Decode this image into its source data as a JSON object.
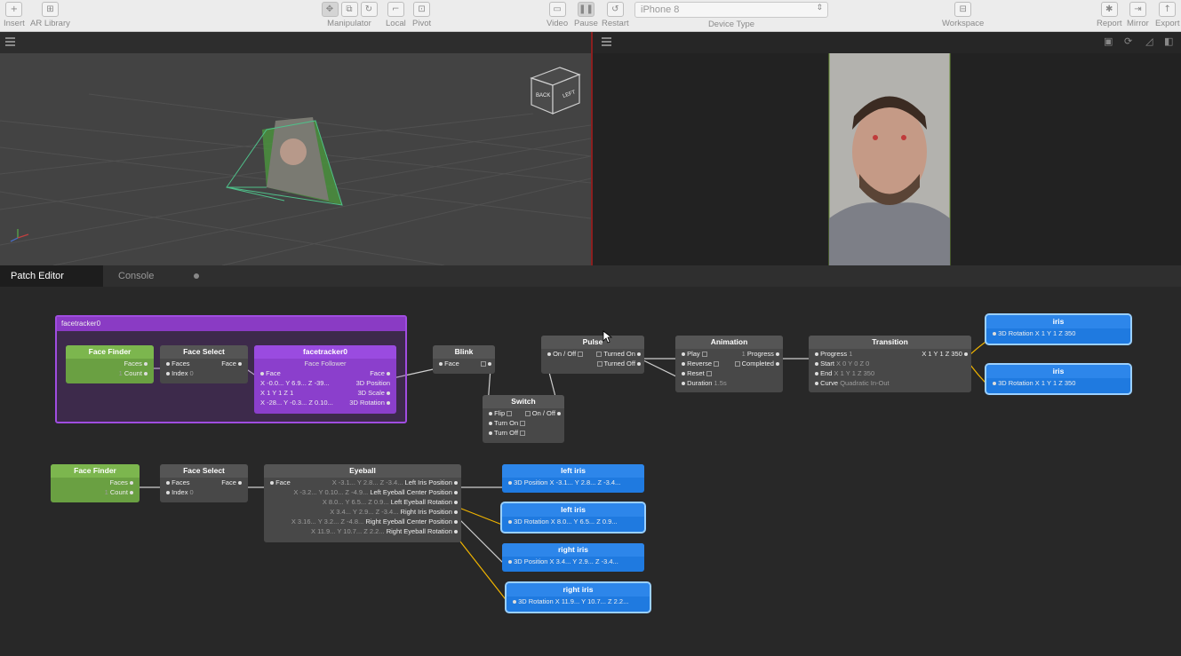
{
  "toolbar": {
    "insert": "Insert",
    "ar_library": "AR Library",
    "manipulator": "Manipulator",
    "local": "Local",
    "pivot": "Pivot",
    "video": "Video",
    "pause": "Pause",
    "restart": "Restart",
    "device_value": "iPhone 8",
    "device_label": "Device Type",
    "workspace": "Workspace",
    "report": "Report",
    "mirror": "Mirror",
    "export": "Export"
  },
  "viewport": {
    "cube_back": "BACK",
    "cube_left": "LEFT"
  },
  "tabs": {
    "patch_editor": "Patch Editor",
    "console": "Console"
  },
  "group": {
    "title": "facetracker0"
  },
  "nodes": {
    "ff1": {
      "title": "Face Finder",
      "faces": "Faces",
      "count_val": "1",
      "count": "Count"
    },
    "fs1": {
      "title": "Face Select",
      "faces": "Faces",
      "face": "Face",
      "index": "Index",
      "index_val": "0"
    },
    "ft": {
      "title": "facetracker0",
      "subtitle": "Face Follower",
      "face_in": "Face",
      "face_out": "Face",
      "r1": "X -0.0... Y 6.9... Z -39...",
      "r1_label": "3D Position",
      "r2": "X 1 Y 1 Z 1",
      "r2_label": "3D Scale",
      "r3": "X -28... Y -0.3... Z 0.10...",
      "r3_label": "3D Rotation"
    },
    "blink": {
      "title": "Blink",
      "face": "Face"
    },
    "switch": {
      "title": "Switch",
      "flip": "Flip",
      "onoff": "On / Off",
      "turn_on": "Turn On",
      "turn_off": "Turn Off"
    },
    "pulse": {
      "title": "Pulse",
      "onoff": "On / Off",
      "turned_on": "Turned On",
      "turned_off": "Turned Off"
    },
    "anim": {
      "title": "Animation",
      "play": "Play",
      "reverse": "Reverse",
      "reset": "Reset",
      "duration": "Duration",
      "duration_val": "1.5s",
      "progress_val": "1",
      "progress": "Progress",
      "completed": "Completed"
    },
    "trans": {
      "title": "Transition",
      "progress": "Progress",
      "progress_val": "1",
      "start": "Start",
      "start_val": "X 0   Y 0   Z 0",
      "end": "End",
      "end_val": "X 1   Y 1   Z 350",
      "curve": "Curve",
      "curve_val": "Quadratic In-Out",
      "out_val": "X   1 Y   1 Z   350"
    },
    "iris1": {
      "title": "iris",
      "label": "3D Rotation",
      "val": "X 1   Y 1   Z 350"
    },
    "iris2": {
      "title": "iris",
      "label": "3D Rotation",
      "val": "X 1   Y 1   Z 350"
    },
    "ff2": {
      "title": "Face Finder",
      "faces": "Faces",
      "count_val": "1",
      "count": "Count"
    },
    "fs2": {
      "title": "Face Select",
      "faces": "Faces",
      "face": "Face",
      "index": "Index",
      "index_val": "0"
    },
    "eyeball": {
      "title": "Eyeball",
      "face": "Face",
      "o1": "Left Iris Position",
      "o1v": "X -3.1... Y 2.8... Z -3.4...",
      "o2": "Left Eyeball Center Position",
      "o2v": "X -3.2... Y 0.10... Z -4.9...",
      "o3": "Left Eyeball Rotation",
      "o3v": "X 8.0... Y 6.5... Z 0.9...",
      "o4": "Right Iris Position",
      "o4v": "X 3.4... Y 2.9... Z -3.4...",
      "o5": "Right Eyeball Center Position",
      "o5v": "X 3.16... Y 3.2... Z -4.8...",
      "o6": "Right Eyeball Rotation",
      "o6v": "X 11.9... Y 10.7... Z 2.2..."
    },
    "liris_pos": {
      "title": "left iris",
      "label": "3D Position",
      "val": "X -3.1...  Y 2.8...  Z -3.4..."
    },
    "liris_rot": {
      "title": "left iris",
      "label": "3D Rotation",
      "val": "X 8.0...  Y 6.5...  Z 0.9..."
    },
    "riris_pos": {
      "title": "right iris",
      "label": "3D Position",
      "val": "X 3.4...  Y 2.9...  Z -3.4..."
    },
    "riris_rot": {
      "title": "right iris",
      "label": "3D Rotation",
      "val": "X 11.9...  Y 10.7...  Z 2.2..."
    }
  },
  "colors": {
    "group": "#8b3fcc",
    "green": "#6aa042",
    "blue": "#1f7ae0",
    "wire_active": "#f0b400"
  }
}
